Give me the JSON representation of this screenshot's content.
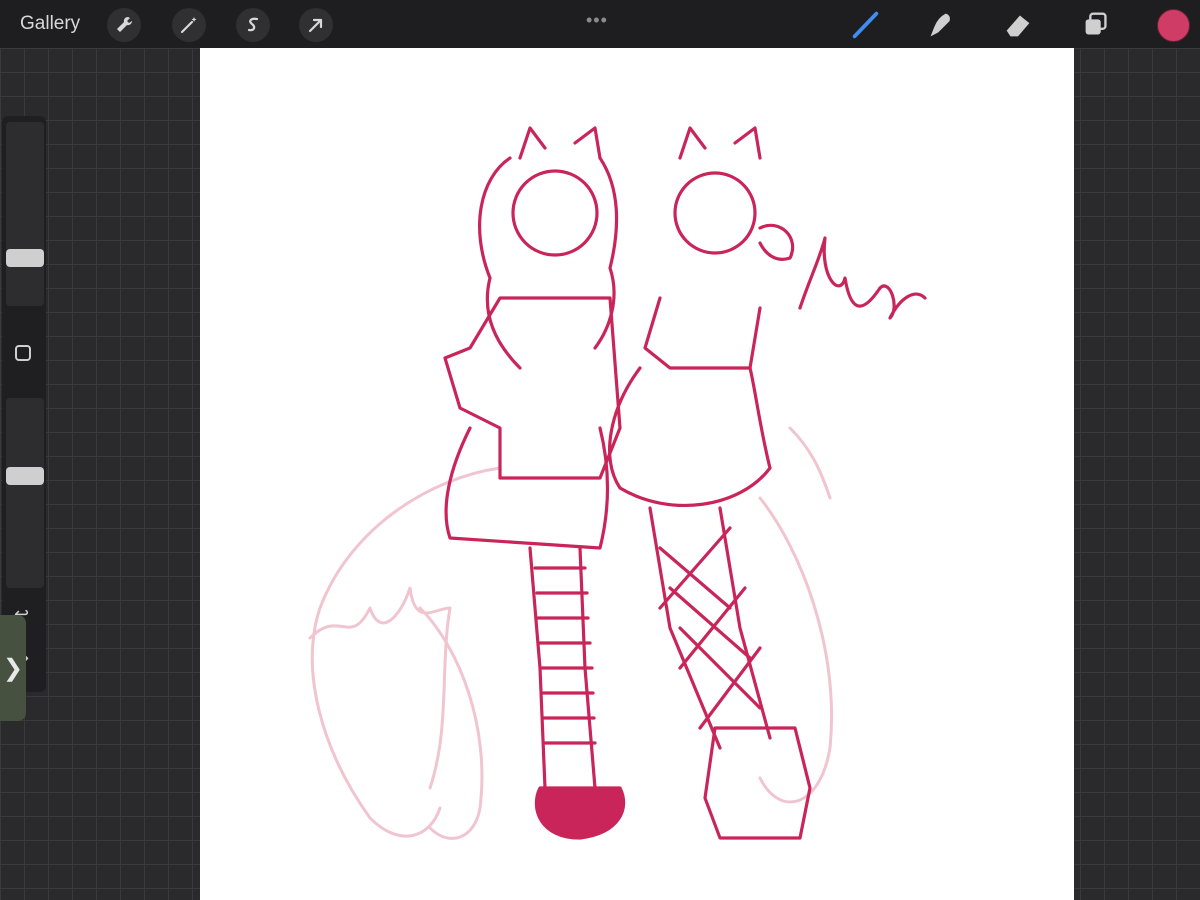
{
  "topbar": {
    "gallery_label": "Gallery",
    "left_tools": [
      "wrench-icon",
      "magic-wand-icon",
      "selection-icon",
      "transform-arrow-icon"
    ],
    "more_label": "•••",
    "right_tools": [
      "brush-icon",
      "smudge-icon",
      "eraser-icon",
      "layers-icon"
    ],
    "current_color": "#cf3c66"
  },
  "sidebar": {
    "brush_size_level": 0.3,
    "opacity_level": 0.4,
    "expand_glyph": "❯"
  },
  "canvas": {
    "background": "#ffffff",
    "ink_color": "#c9255a",
    "sketch_color": "#f0c5cf"
  }
}
